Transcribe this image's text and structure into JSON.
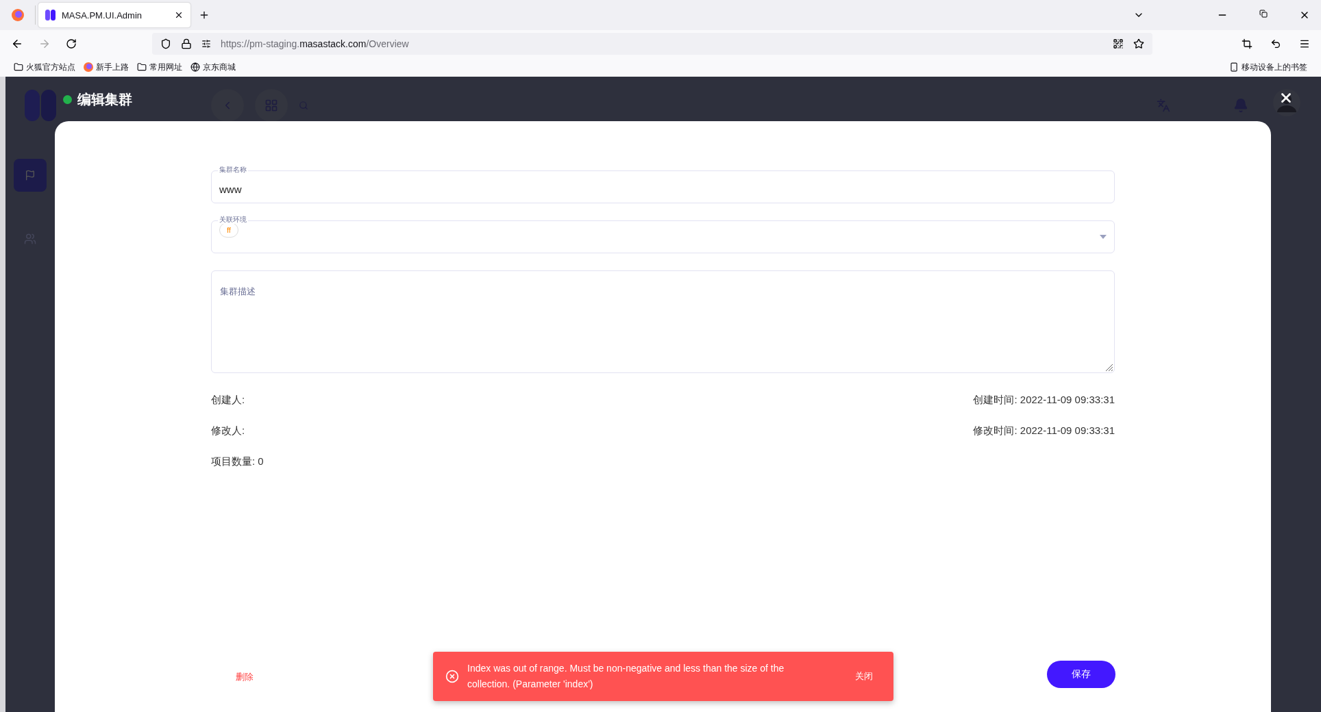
{
  "browser": {
    "tab_title": "MASA.PM.UI.Admin",
    "url_prefix": "https://pm-staging.",
    "url_domain": "masastack.com",
    "url_path": "/Overview",
    "bookmarks": [
      {
        "label": "火狐官方站点",
        "kind": "folder"
      },
      {
        "label": "新手上路",
        "kind": "firefox"
      },
      {
        "label": "常用网址",
        "kind": "folder"
      },
      {
        "label": "京东商城",
        "kind": "globe"
      }
    ],
    "mobile_bookmarks": "移动设备上的书签"
  },
  "dialog": {
    "title": "编辑集群",
    "fields": [
      {
        "kind": "text",
        "label": "集群名称",
        "value": "www"
      },
      {
        "kind": "select",
        "label": "关联环境",
        "chips": [
          {
            "label": "ff",
            "color": "#ff8a00"
          }
        ]
      },
      {
        "kind": "textarea",
        "placeholder": "集群描述"
      }
    ],
    "info_rows": [
      {
        "left": "创建人:",
        "right": "创建时间: 2022-11-09 09:33:31"
      },
      {
        "left": "修改人:",
        "right": "修改时间: 2022-11-09 09:33:31"
      },
      {
        "left": "项目数量:  0"
      }
    ],
    "delete_label": "删除",
    "save_label": "保存"
  },
  "snackbar": {
    "message": "Index was out of range. Must be non-negative and less than the size of the collection. (Parameter 'index')",
    "action": "关闭"
  }
}
